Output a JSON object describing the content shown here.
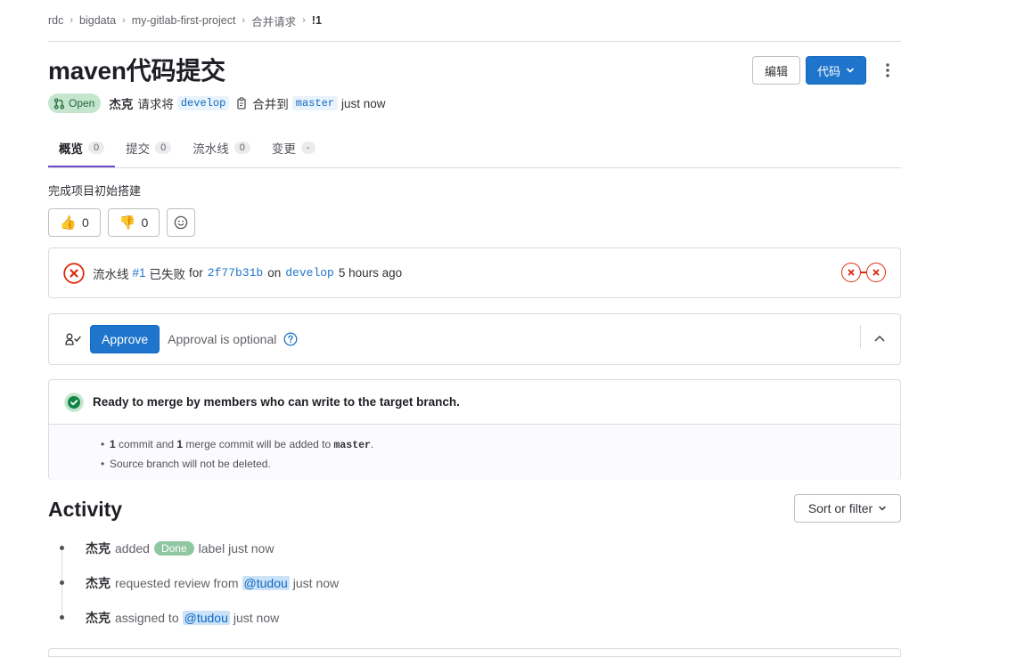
{
  "breadcrumb": {
    "items": [
      "rdc",
      "bigdata",
      "my-gitlab-first-project",
      "合并请求",
      "!1"
    ],
    "separator": "›"
  },
  "title": "maven代码提交",
  "actions": {
    "edit_label": "编辑",
    "code_label": "代码",
    "more_icon": "kebab-icon"
  },
  "meta": {
    "status": "Open",
    "author": "杰克",
    "request_text": "请求将",
    "source_branch": "develop",
    "merge_into_text": "合并到",
    "target_branch": "master",
    "time": "just now"
  },
  "tabs": [
    {
      "label": "概览",
      "count": "0"
    },
    {
      "label": "提交",
      "count": "0"
    },
    {
      "label": "流水线",
      "count": "0"
    },
    {
      "label": "变更",
      "count": "-"
    }
  ],
  "description": "完成项目初始搭建",
  "reactions": {
    "thumbs_up": {
      "emoji": "👍",
      "count": "0"
    },
    "thumbs_down": {
      "emoji": "👎",
      "count": "0"
    }
  },
  "pipeline": {
    "prefix": "流水线",
    "id": "#1",
    "status_text": "已失败",
    "for_text": "for",
    "commit": "2f77b31b",
    "on_text": "on",
    "branch": "develop",
    "time": "5 hours ago"
  },
  "approval": {
    "button": "Approve",
    "text": "Approval is optional"
  },
  "merge": {
    "heading": "Ready to merge by members who can write to the target branch.",
    "line1": {
      "c1": "1",
      "t1": " commit and ",
      "c2": "1",
      "t2": " merge commit will be added to ",
      "branch": "master",
      "end": "."
    },
    "line2": "Source branch will not be deleted."
  },
  "activity": {
    "title": "Activity",
    "sort_label": "Sort or filter",
    "events": [
      {
        "who": "杰克",
        "before": "added",
        "label": "Done",
        "after": "label just now"
      },
      {
        "who": "杰克",
        "before": "requested review from",
        "mention": "@tudou",
        "after": "just now"
      },
      {
        "who": "杰克",
        "before": "assigned to",
        "mention": "@tudou",
        "after": "just now"
      }
    ]
  },
  "colors": {
    "primary": "#1f75cb",
    "open_bg": "#c3e6cd",
    "open_text": "#24663b",
    "failed": "#dd2b0e",
    "success": "#108548",
    "done_label": "#8fc7a0",
    "active_tab": "#6e49cb"
  }
}
